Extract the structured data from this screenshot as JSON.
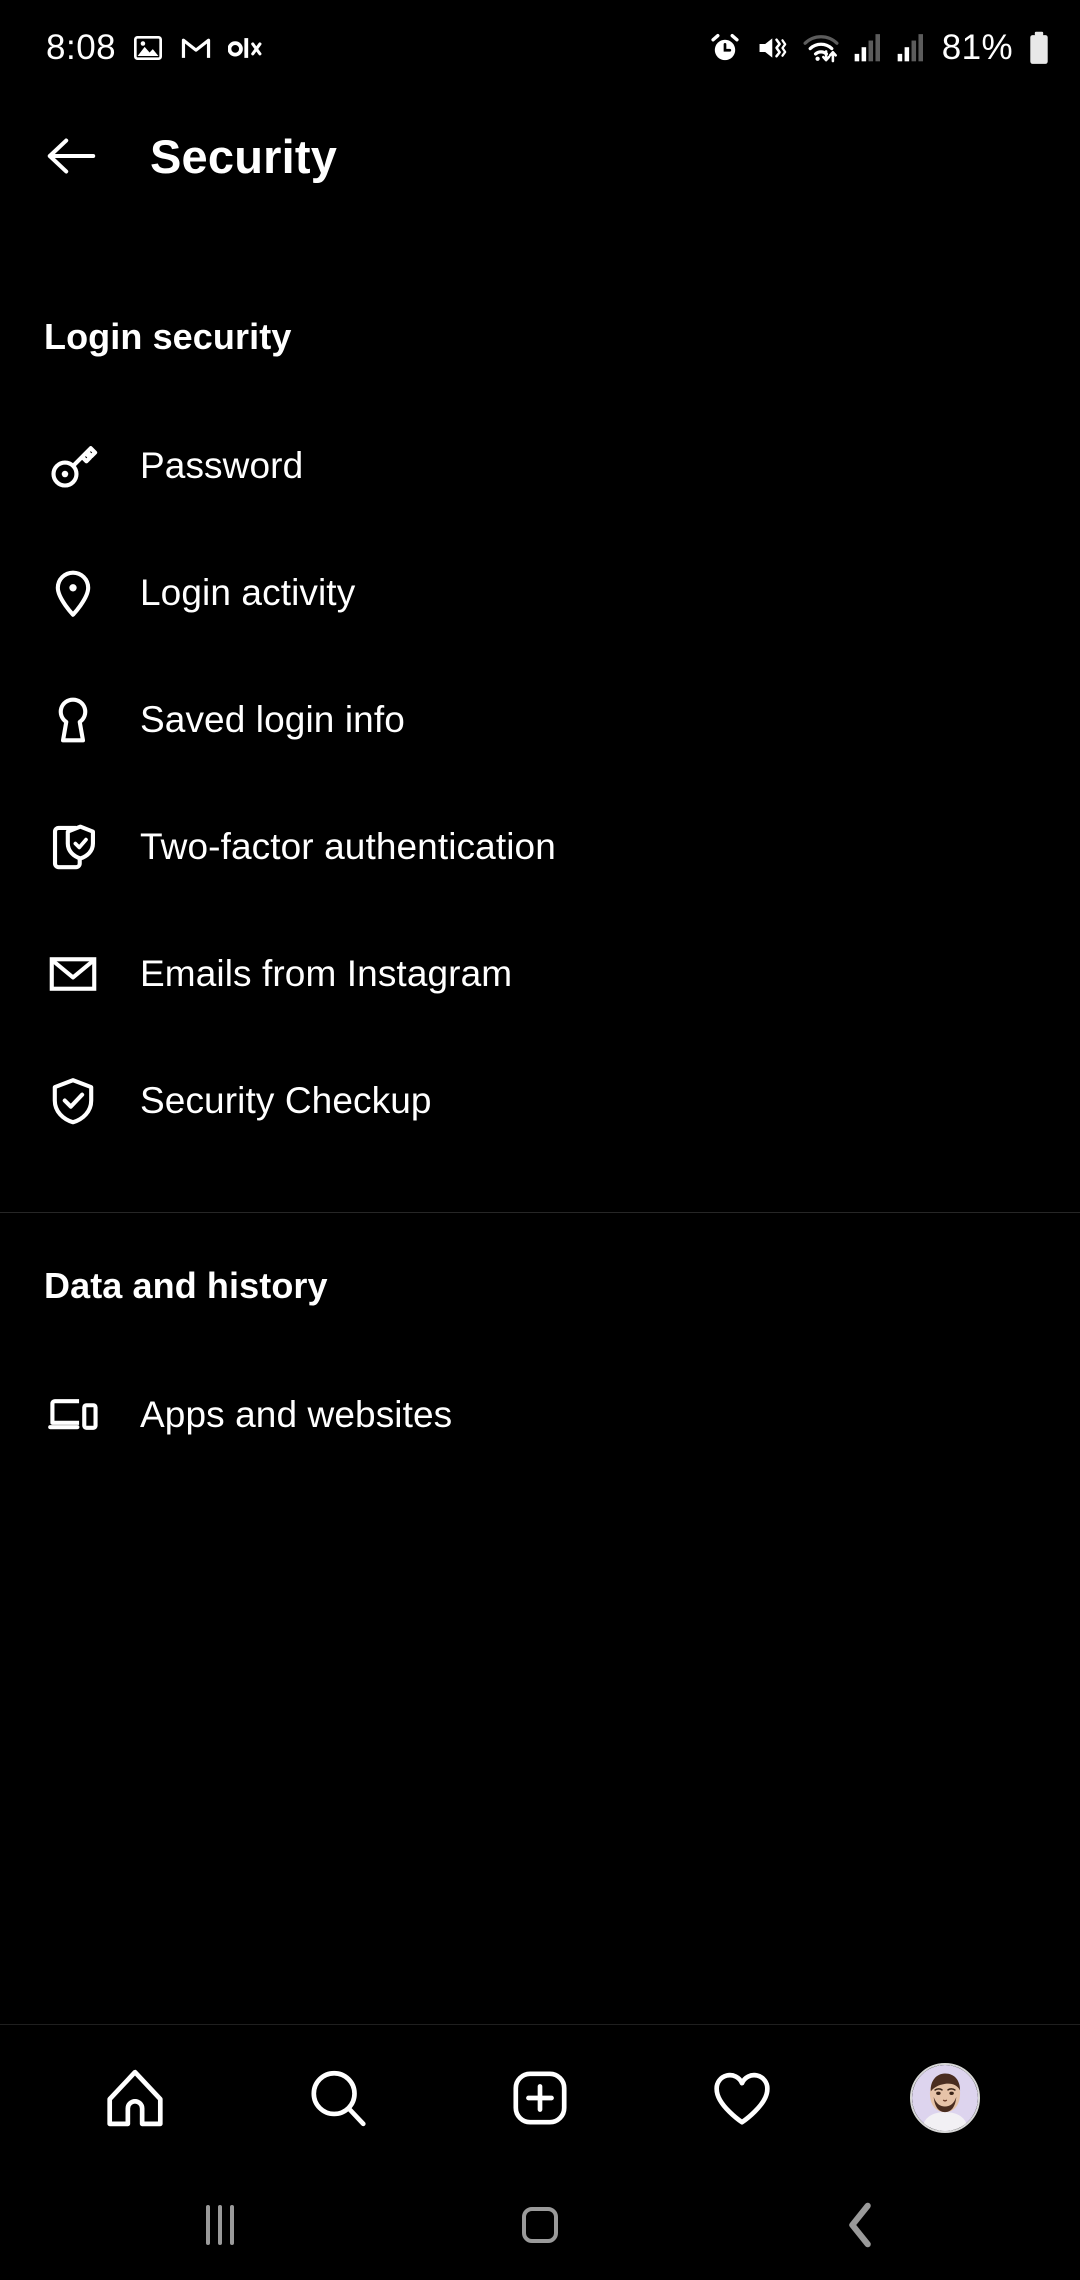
{
  "statusbar": {
    "time": "8:08",
    "left_icons": [
      {
        "name": "gallery-icon",
        "label": "Gallery"
      },
      {
        "name": "gmail-icon",
        "label": "M"
      },
      {
        "name": "olx-icon",
        "label": "olx"
      }
    ],
    "right_icons": [
      {
        "name": "alarm-icon",
        "label": "Alarm"
      },
      {
        "name": "sound-vibrate-off-icon",
        "label": "Mute"
      },
      {
        "name": "wifi-icon",
        "label": "Wi-Fi"
      },
      {
        "name": "signal-sim1-icon",
        "label": "Signal 1"
      },
      {
        "name": "signal-sim2-icon",
        "label": "Signal 2"
      }
    ],
    "battery_percent": "81%",
    "battery_level": 81
  },
  "header": {
    "title": "Security",
    "back_icon": "arrow-left-icon"
  },
  "sections": [
    {
      "id": "login-security",
      "title": "Login security",
      "items": [
        {
          "id": "password",
          "label": "Password",
          "icon": "key-icon"
        },
        {
          "id": "login-activity",
          "label": "Login activity",
          "icon": "location-pin-icon"
        },
        {
          "id": "saved-login-info",
          "label": "Saved login info",
          "icon": "keyhole-icon"
        },
        {
          "id": "two-factor-authentication",
          "label": "Two-factor authentication",
          "icon": "phone-shield-check-icon"
        },
        {
          "id": "emails-from-instagram",
          "label": "Emails from Instagram",
          "icon": "envelope-icon"
        },
        {
          "id": "security-checkup",
          "label": "Security Checkup",
          "icon": "shield-check-icon"
        }
      ]
    },
    {
      "id": "data-and-history",
      "title": "Data and history",
      "items": [
        {
          "id": "apps-and-websites",
          "label": "Apps and websites",
          "icon": "laptop-phone-icon"
        }
      ]
    }
  ],
  "tabbar": {
    "items": [
      {
        "id": "home",
        "label": "Home",
        "icon": "home-icon"
      },
      {
        "id": "search",
        "label": "Search",
        "icon": "search-icon"
      },
      {
        "id": "create",
        "label": "Create",
        "icon": "plus-square-icon"
      },
      {
        "id": "activity",
        "label": "Activity",
        "icon": "heart-icon"
      },
      {
        "id": "profile",
        "label": "Profile",
        "icon": "avatar"
      }
    ]
  },
  "androidnav": {
    "items": [
      {
        "id": "recents",
        "label": "Recents",
        "icon": "recents-icon"
      },
      {
        "id": "home",
        "label": "Home",
        "icon": "home-square-icon"
      },
      {
        "id": "back",
        "label": "Back",
        "icon": "chevron-left-icon"
      }
    ]
  },
  "colors": {
    "background": "#000000",
    "text": "#ffffff",
    "divider": "#262626",
    "nav_icon": "#9a9a9a",
    "avatar_bg": "#ddd4ee"
  }
}
